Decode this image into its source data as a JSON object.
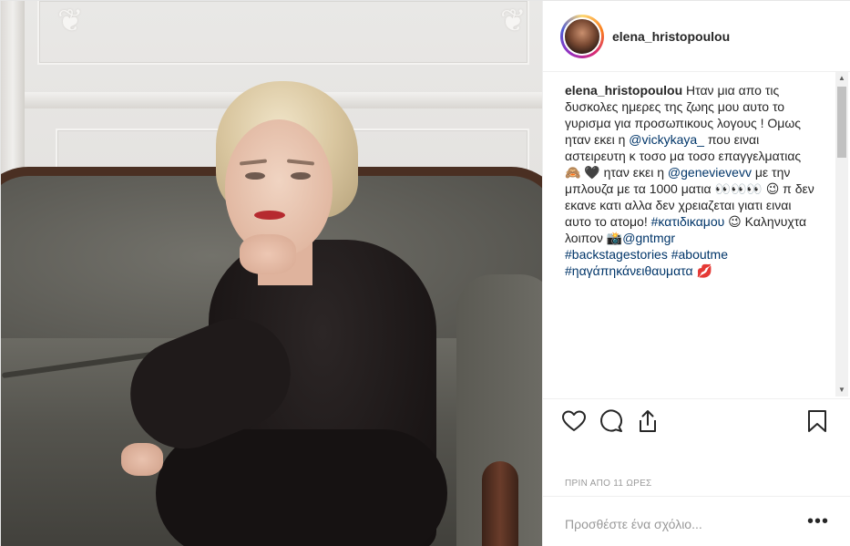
{
  "header": {
    "username": "elena_hristopoulou"
  },
  "caption": {
    "username": "elena_hristopoulou",
    "part1": " Ηταν μια απο τις δυσκολες ημερες της ζωης μου αυτο το γυρισμα για προσωπικους λογους ! Ομως ηταν εκει η ",
    "mention1": "@vickykaya_",
    "part2": " που ειναι αστειρευτη κ τοσο μα τοσο επαγγελματιας 🙈 🖤 ηταν εκει η ",
    "mention2": "@genevievevv",
    "part3": " με την μπλουζα με τα 1000 ματια 👀👀👀 😉 π δεν εκανε κατι αλλα δεν χρειαζεται γιατι ειναι αυτο το ατομο! ",
    "hashtag1": "#κατιδικαμου",
    "part4": " 😉 Καληνυχτα λοιπον 📸",
    "mention3": "@gntmgr",
    "hashtag2": "#backstagestories",
    "hashtag3": "#aboutme",
    "hashtag4": "#ηαγάπηκάνειθαυματα",
    "part5": " 💋"
  },
  "actions": {
    "icons": [
      "heart-icon",
      "comment-icon",
      "share-icon",
      "bookmark-icon"
    ]
  },
  "timestamp": "ΠΡΙΝ ΑΠΟ 11 ΩΡΕΣ",
  "comment": {
    "placeholder": "Προσθέστε ένα σχόλιο...",
    "more": "•••"
  },
  "colors": {
    "link": "#003569",
    "text": "#262626",
    "muted": "#999999"
  }
}
